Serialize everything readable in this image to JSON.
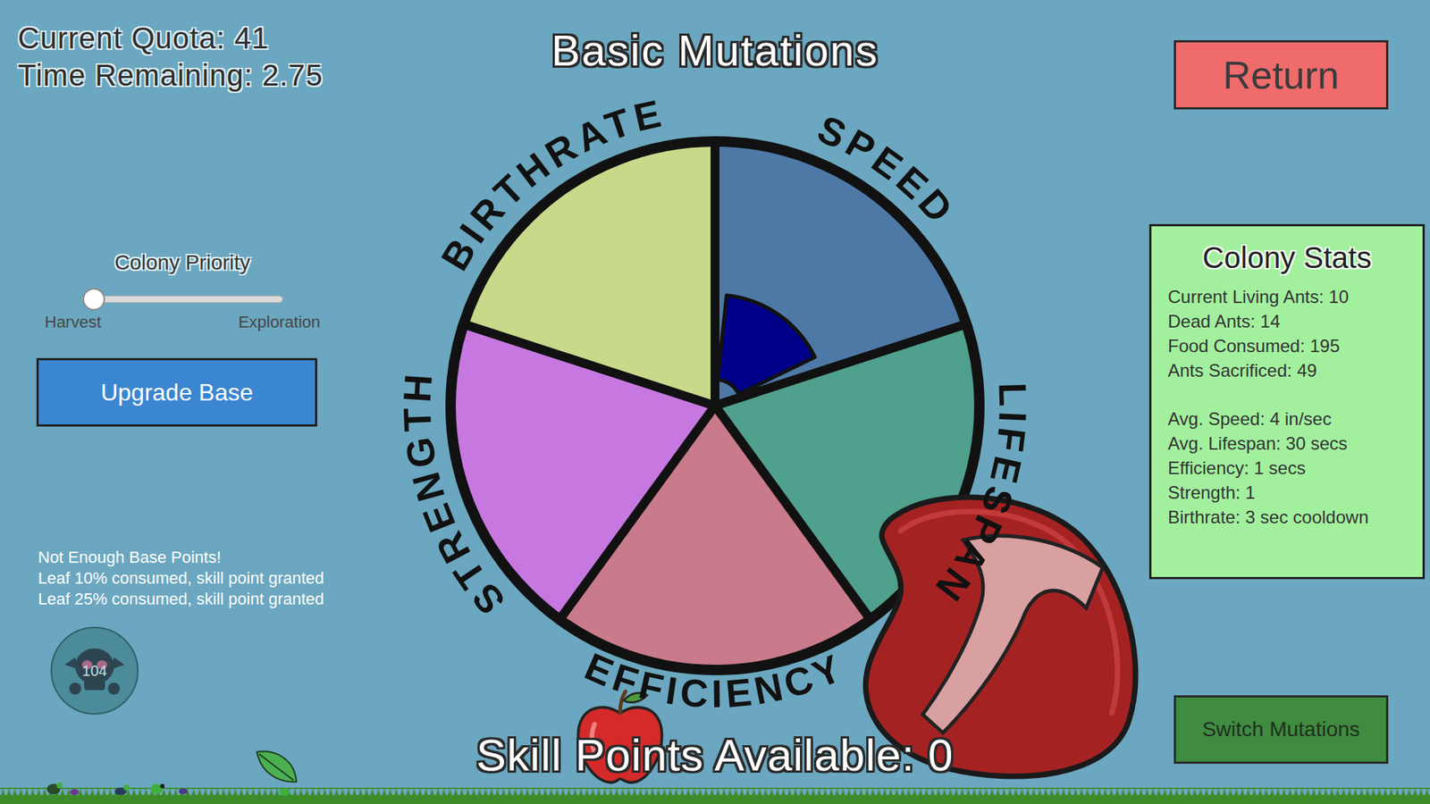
{
  "hud": {
    "quota": "Current Quota: 41",
    "time": "Time Remaining: 2.75"
  },
  "title": "Basic Mutations",
  "return_button": "Return",
  "priority": {
    "label": "Colony Priority",
    "level": 0,
    "min_label": "Harvest",
    "max_label": "Exploration"
  },
  "upgrade_button": "Upgrade Base",
  "log": [
    "Not Enough Base Points!",
    "Leaf 10% consumed, skill point granted",
    "Leaf 25% consumed, skill point granted"
  ],
  "ant_badge": {
    "count": "104"
  },
  "mutations": [
    {
      "label": "SPEED",
      "color": "#4e79a6",
      "level": 0.42
    },
    {
      "label": "LIFESPAN",
      "color": "#4fa08c",
      "level": 0
    },
    {
      "label": "EFFICIENCY",
      "color": "#c97b8b",
      "level": 0
    },
    {
      "label": "STRENGTH",
      "color": "#c678e0",
      "level": 0
    },
    {
      "label": "BIRTHRATE",
      "color": "#c8d98a",
      "level": 0
    }
  ],
  "skill_points": "Skill Points Available: 0",
  "stats": {
    "title": "Colony Stats",
    "groups": [
      [
        "Current Living Ants: 10",
        "Dead Ants: 14",
        "Food Consumed: 195",
        "Ants Sacrificed: 49"
      ],
      [
        "Avg. Speed: 4 in/sec",
        "Avg. Lifespan: 30 secs",
        "Efficiency: 1 secs",
        "Strength: 1",
        "Birthrate: 3 sec cooldown"
      ]
    ]
  },
  "switch_button": "Switch Mutations"
}
